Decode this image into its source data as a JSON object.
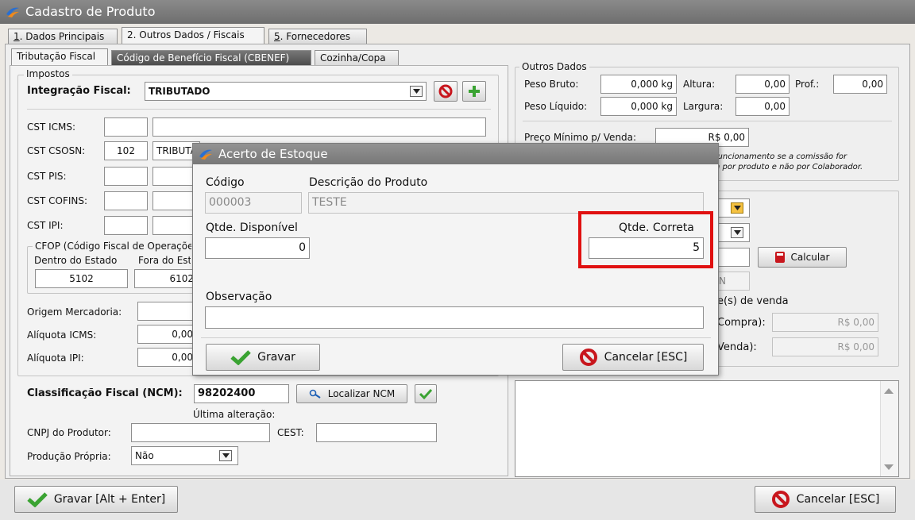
{
  "window": {
    "title": "Cadastro de Produto"
  },
  "main_tabs": [
    {
      "prefix": "1",
      "label": ". Dados Principais"
    },
    {
      "prefix": "2",
      "label": ". Outros Dados / Fiscais"
    },
    {
      "prefix": "5",
      "label": ". Fornecedores"
    }
  ],
  "sub_tabs": [
    "Tributação Fiscal",
    "Código de Benefício Fiscal (CBENEF)",
    "Cozinha/Copa"
  ],
  "impostos": {
    "group_label": "Impostos",
    "integracao_label": "Integração Fiscal:",
    "integracao_value": "TRIBUTADO",
    "cst_icms_label": "CST ICMS:",
    "cst_csosn_label": "CST CSOSN:",
    "cst_csosn_code": "102",
    "cst_csosn_desc": "TRIBUTADO",
    "cst_pis_label": "CST PIS:",
    "cst_cofins_label": "CST COFINS:",
    "cst_ipi_label": "CST IPI:",
    "cfop_label": "CFOP (Código Fiscal de Operações)",
    "dentro_label": "Dentro do Estado",
    "fora_label": "Fora do Estado",
    "dentro_value": "5102",
    "fora_value": "6102",
    "origem_label": "Origem Mercadoria:",
    "aliq_icms_label": "Alíquota ICMS:",
    "aliq_icms_value": "0,00",
    "aliq_ipi_label": "Alíquota IPI:",
    "aliq_ipi_value": "0,00"
  },
  "ncm": {
    "label": "Classificação Fiscal (NCM):",
    "value": "98202400",
    "localizar_label": "Localizar NCM",
    "ultima_label": "Última alteração:",
    "cnpj_label": "CNPJ do Produtor:",
    "cest_label": "CEST:",
    "producao_label": "Produção Própria:",
    "producao_value": "Não"
  },
  "outros": {
    "group_label": "Outros Dados",
    "peso_bruto_label": "Peso Bruto:",
    "peso_bruto_value": "0,000 kg",
    "altura_label": "Altura:",
    "altura_value": "0,00",
    "prof_label": "Prof.:",
    "prof_value": "0,00",
    "peso_liquido_label": "Peso Líquido:",
    "peso_liquido_value": "0,000 kg",
    "largura_label": "Largura:",
    "largura_value": "0,00",
    "preco_minimo_label": "Preço Mínimo p/ Venda:",
    "preco_minimo_value": "R$ 0,00",
    "note_line1": "funcionamento se a comissão for",
    "note_line2": "n por produto e não por Colaborador."
  },
  "right_group": {
    "calcular_label": "Calcular",
    "disabled_text": "N",
    "venda_heading": "e(s) de venda",
    "compra_label": "Compra):",
    "compra_value": "R$ 0,00",
    "venda_label": "Venda):",
    "venda_value": "R$ 0,00"
  },
  "dialog": {
    "title": "Acerto de Estoque",
    "codigo_label": "Código",
    "codigo_value": "000003",
    "descricao_label": "Descrição do Produto",
    "descricao_value": "TESTE",
    "qtde_disp_label": "Qtde. Disponível",
    "qtde_disp_value": "0",
    "qtde_correta_label": "Qtde. Correta",
    "qtde_correta_value": "5",
    "observacao_label": "Observação",
    "observacao_value": "",
    "gravar_label": "Gravar",
    "cancelar_label": "Cancelar [ESC]"
  },
  "footer": {
    "gravar_label": "Gravar [Alt + Enter]",
    "cancelar_label": "Cancelar [ESC]"
  },
  "colors": {
    "highlight": "#e01010",
    "accept_green": "#3aa332",
    "cancel_red": "#c8161d",
    "title_gray": "#7a7a7a"
  }
}
